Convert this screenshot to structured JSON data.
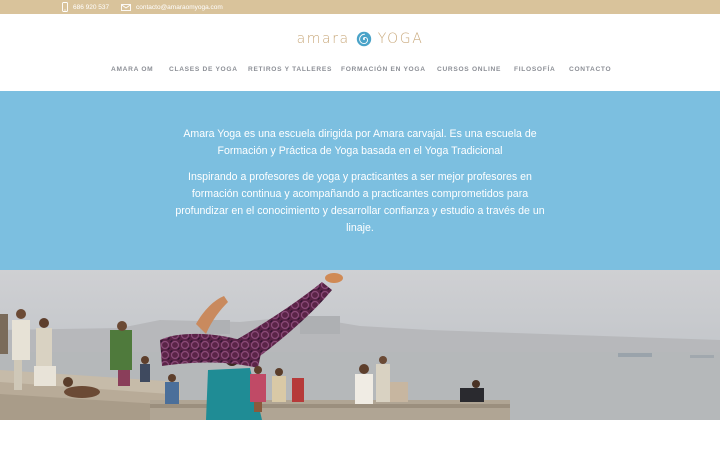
{
  "topbar": {
    "phone": "686 920 537",
    "email": "contacto@amaraomyoga.com",
    "phone_icon": "phone-icon",
    "email_icon": "envelope-icon"
  },
  "logo": {
    "left_word": "amara",
    "right_word": "YOGA",
    "mark_icon": "spiral-icon"
  },
  "nav": {
    "items": [
      {
        "label": "AMARA OM"
      },
      {
        "label": "CLASES DE YOGA"
      },
      {
        "label": "RETIROS Y TALLERES"
      },
      {
        "label": "FORMACIÓN EN YOGA"
      },
      {
        "label": "CURSOS ONLINE"
      },
      {
        "label": "FILOSOFÍA"
      },
      {
        "label": "CONTACTO"
      }
    ]
  },
  "hero": {
    "paragraph1": "Amara Yoga es una escuela dirigida por Amara carvajal. Es una escuela de Formación y Práctica de Yoga basada en el Yoga Tradicional",
    "paragraph2": "Inspirando a profesores de yoga y practicantes a ser mejor profesores en formación continua y acompañando a practicantes comprometidos para profundizar en el conocimiento y desarrollar confianza y estudio a través de un linaje."
  },
  "colors": {
    "topbar": "#d9c39b",
    "brand_gold": "#c9a97c",
    "brand_blue": "#4aa3c8",
    "nav_text": "#8c8f96",
    "hero_band": "#7cbfe0"
  }
}
